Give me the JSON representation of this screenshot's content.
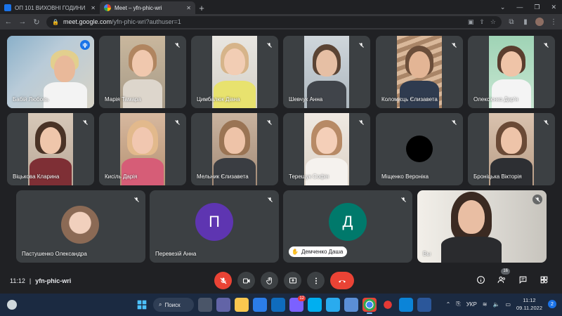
{
  "browser": {
    "tabs": [
      {
        "title": "ОП 101 ВИХОВНІ ГОДИНИ",
        "active": false
      },
      {
        "title": "Meet – yfn-phic-wri",
        "active": true
      }
    ],
    "url_host": "meet.google.com",
    "url_path": "/yfn-phic-wri?authuser=1"
  },
  "participants": [
    {
      "name": "Бабій Любовь",
      "speaking": true
    },
    {
      "name": "Марія Тамара"
    },
    {
      "name": "Цимбалюк Діана"
    },
    {
      "name": "Шевчук Анна"
    },
    {
      "name": "Коломієць Єлизавета"
    },
    {
      "name": "Олексієнко Дар'я"
    },
    {
      "name": "Віцькова Кларина"
    },
    {
      "name": "Кисіль Дарія"
    },
    {
      "name": "Мельник Єлизавета"
    },
    {
      "name": "Терещук Софія"
    },
    {
      "name": "Міщенко Вероніка"
    },
    {
      "name": "Броніцька Вікторія"
    },
    {
      "name": "Пастушенко Олександра"
    },
    {
      "name": "Перевезій Анна",
      "initial": "П",
      "avatar_color": "#5e35b1"
    },
    {
      "name": "Демченко Даша",
      "initial": "Д",
      "avatar_color": "#00796b",
      "hand_raised": true
    },
    {
      "name": "Вы"
    }
  ],
  "meeting": {
    "time": "11:12",
    "separator": "|",
    "code": "yfn-phic-wri",
    "participant_count": "16"
  },
  "taskbar": {
    "search_label": "Поиск",
    "mail_badge": "12",
    "language": "УКР",
    "time": "11:12",
    "date": "09.11.2022",
    "notifications": "2"
  },
  "colors": {
    "background": "#202124",
    "tile": "#3c4043",
    "danger": "#ea4335",
    "accent": "#1a73e8"
  }
}
